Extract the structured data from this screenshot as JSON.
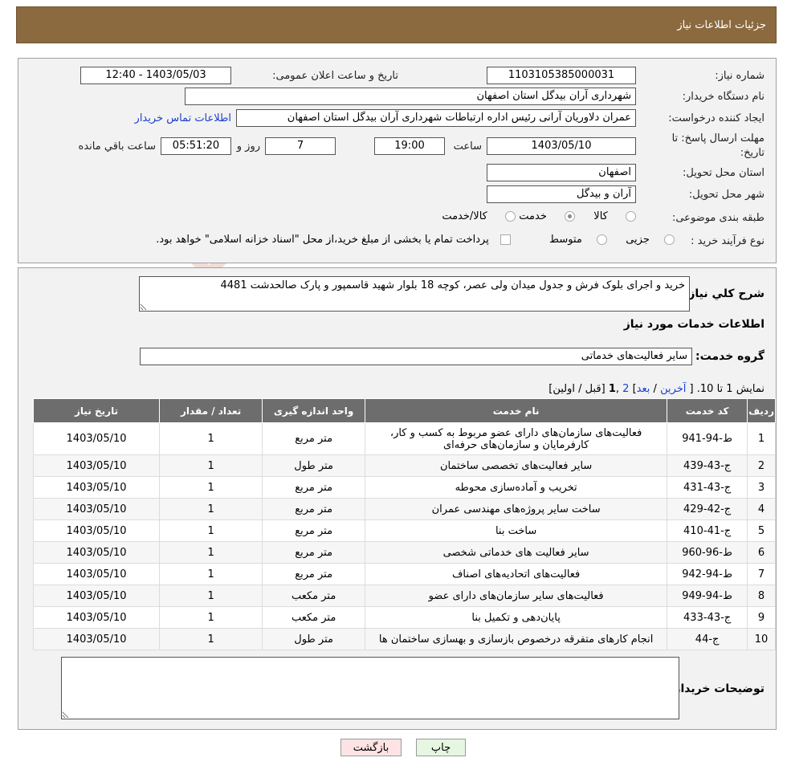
{
  "header": {
    "title": "جزئیات اطلاعات نیاز"
  },
  "form": {
    "need_number_label": "شماره نیاز:",
    "need_number": "1103105385000031",
    "announce_label": "تاریخ و ساعت اعلان عمومی:",
    "announce_value": "1403/05/03 - 12:40",
    "buyer_org_label": "نام دستگاه خریدار:",
    "buyer_org": "شهرداری آران بیدگل استان اصفهان",
    "creator_label": "ایجاد کننده درخواست:",
    "creator": "عمران دلاوریان آرانی رئیس اداره ارتباطات شهرداری آران بیدگل استان اصفهان",
    "contact_link": "اطلاعات تماس خریدار",
    "deadline_label_1": "مهلت ارسال پاسخ: تا",
    "deadline_label_2": "تاریخ:",
    "deadline_date": "1403/05/10",
    "time_label": "ساعت",
    "deadline_time": "19:00",
    "days": "7",
    "days_label": "روز و",
    "remaining": "05:51:20",
    "remaining_label": "ساعت باقي مانده",
    "province_label": "استان محل تحویل:",
    "province": "اصفهان",
    "city_label": "شهر محل تحویل:",
    "city": "آران و بیدگل",
    "category_label": "طبقه بندی موضوعی:",
    "category_options": [
      "کالا",
      "خدمت",
      "کالا/خدمت"
    ],
    "category_selected": "خدمت",
    "process_label": "نوع فرآیند خرید :",
    "process_options": [
      "جزیی",
      "متوسط"
    ],
    "process_selected": "",
    "payment_note": "پرداخت تمام یا بخشی از مبلغ خرید،از محل \"اسناد خزانه اسلامی\" خواهد بود."
  },
  "details": {
    "summary_label": "شرح کلي نياز:",
    "summary": "خرید و اجرای بلوک فرش و جدول میدان ولی عصر، کوچه 18 بلوار شهید قاسمپور و پارک صالحدشت 4481",
    "services_heading": "اطلاعات خدمات مورد نیاز",
    "service_group_label": "گروه خدمت:",
    "service_group": "سایر فعالیت‌های خدماتی",
    "pager_show": "نمایش 1 تا 10.",
    "pager_open": "[",
    "pager_last": "آخرین",
    "pager_sep1": "/",
    "pager_next": "بعد",
    "pager_close_mid": "]",
    "pager_p2": "2",
    "pager_comma": ",",
    "pager_p1": "1",
    "pager_rest": "[قبل / اولین]",
    "buyer_notes_label": "توضیحات خریدار:"
  },
  "table": {
    "headers": [
      "ردیف",
      "کد خدمت",
      "نام خدمت",
      "واحد اندازه گیری",
      "تعداد / مقدار",
      "تاریخ نیاز"
    ],
    "rows": [
      [
        "1",
        "ط-94-941",
        "فعالیت‌های سازمان‌های دارای عضو مربوط به کسب و کار، کارفرمایان و سازمان‌های حرفه‌ای",
        "متر مربع",
        "1",
        "1403/05/10"
      ],
      [
        "2",
        "ج-43-439",
        "سایر فعالیت‌های تخصصی ساختمان",
        "متر طول",
        "1",
        "1403/05/10"
      ],
      [
        "3",
        "ج-43-431",
        "تخریب و آماده‌سازی محوطه",
        "متر مربع",
        "1",
        "1403/05/10"
      ],
      [
        "4",
        "ج-42-429",
        "ساخت سایر پروژه‌های مهندسی عمران",
        "متر مربع",
        "1",
        "1403/05/10"
      ],
      [
        "5",
        "ج-41-410",
        "ساخت بنا",
        "متر مربع",
        "1",
        "1403/05/10"
      ],
      [
        "6",
        "ط-96-960",
        "سایر فعالیت های خدماتی شخصی",
        "متر مربع",
        "1",
        "1403/05/10"
      ],
      [
        "7",
        "ط-94-942",
        "فعالیت‌های اتحادیه‌های اصناف",
        "متر مربع",
        "1",
        "1403/05/10"
      ],
      [
        "8",
        "ط-94-949",
        "فعالیت‌های سایر سازمان‌های دارای عضو",
        "متر مکعب",
        "1",
        "1403/05/10"
      ],
      [
        "9",
        "ج-43-433",
        "پایان‌دهی و تکمیل بنا",
        "متر مکعب",
        "1",
        "1403/05/10"
      ],
      [
        "10",
        "ج-44",
        "انجام کارهای متفرقه درخصوص بازسازی و بهسازی ساختمان ها",
        "متر طول",
        "1",
        "1403/05/10"
      ]
    ]
  },
  "buttons": {
    "print": "چاپ",
    "back": "بازگشت"
  },
  "watermark": {
    "text": "AriaTender.neT"
  },
  "colors": {
    "header_bg": "#8b6a3f",
    "table_header_bg": "#6d6d6d",
    "link": "#1a3fd1",
    "back_btn_bg": "#fde3e3",
    "print_btn_bg": "#e6f7e1"
  }
}
